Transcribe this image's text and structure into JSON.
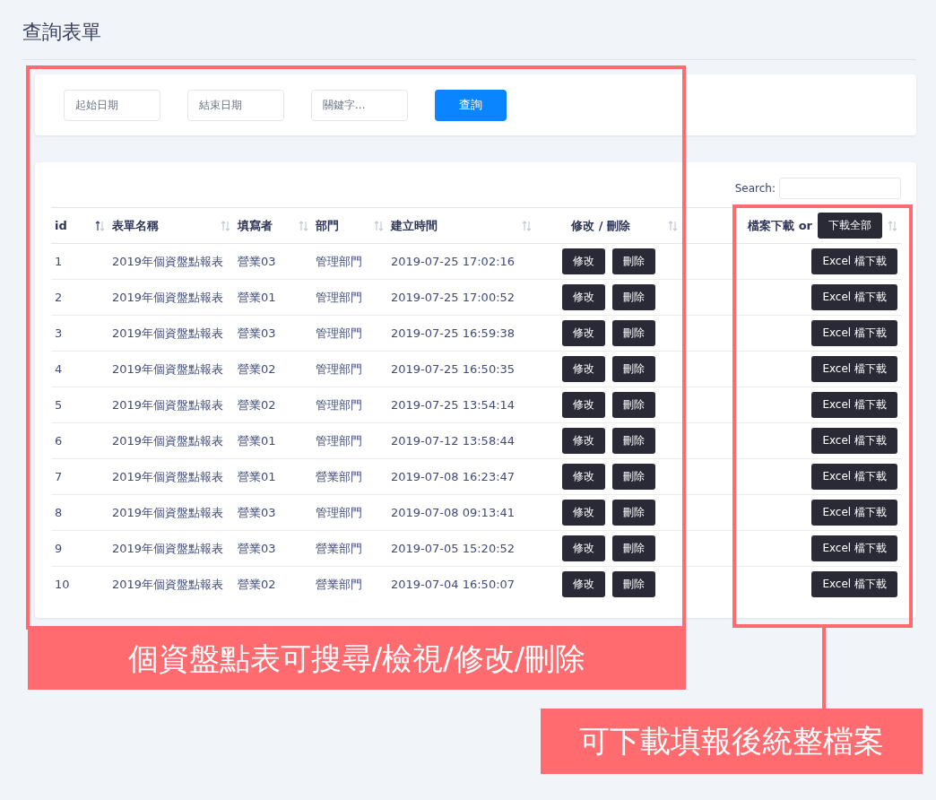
{
  "page": {
    "title": "查詢表單"
  },
  "filters": {
    "fields": [
      {
        "placeholder": "起始日期"
      },
      {
        "placeholder": "結束日期"
      },
      {
        "placeholder": "關鍵字..."
      }
    ],
    "submit": "查詢"
  },
  "table": {
    "search_label": "Search:",
    "columns": [
      {
        "label": "id",
        "sorted": true
      },
      {
        "label": "表單名稱",
        "sorted": false
      },
      {
        "label": "填寫者",
        "sorted": false
      },
      {
        "label": "部門",
        "sorted": false
      },
      {
        "label": "建立時間",
        "sorted": false
      },
      {
        "label": "修改 / 刪除",
        "sorted": false
      },
      {
        "label": "檔案下載 or",
        "button": "下載全部",
        "sorted": false
      }
    ],
    "rows": [
      {
        "id": "1",
        "name": "2019年個資盤點報表",
        "writer": "營業03",
        "dept": "管理部門",
        "created": "2019-07-25 17:02:16",
        "edit": "修改",
        "delete": "刪除",
        "download": "Excel 檔下載"
      },
      {
        "id": "2",
        "name": "2019年個資盤點報表",
        "writer": "營業01",
        "dept": "管理部門",
        "created": "2019-07-25 17:00:52",
        "edit": "修改",
        "delete": "刪除",
        "download": "Excel 檔下載"
      },
      {
        "id": "3",
        "name": "2019年個資盤點報表",
        "writer": "營業03",
        "dept": "管理部門",
        "created": "2019-07-25 16:59:38",
        "edit": "修改",
        "delete": "刪除",
        "download": "Excel 檔下載"
      },
      {
        "id": "4",
        "name": "2019年個資盤點報表",
        "writer": "營業02",
        "dept": "管理部門",
        "created": "2019-07-25 16:50:35",
        "edit": "修改",
        "delete": "刪除",
        "download": "Excel 檔下載"
      },
      {
        "id": "5",
        "name": "2019年個資盤點報表",
        "writer": "營業02",
        "dept": "管理部門",
        "created": "2019-07-25 13:54:14",
        "edit": "修改",
        "delete": "刪除",
        "download": "Excel 檔下載"
      },
      {
        "id": "6",
        "name": "2019年個資盤點報表",
        "writer": "營業01",
        "dept": "管理部門",
        "created": "2019-07-12 13:58:44",
        "edit": "修改",
        "delete": "刪除",
        "download": "Excel 檔下載"
      },
      {
        "id": "7",
        "name": "2019年個資盤點報表",
        "writer": "營業01",
        "dept": "營業部門",
        "created": "2019-07-08 16:23:47",
        "edit": "修改",
        "delete": "刪除",
        "download": "Excel 檔下載"
      },
      {
        "id": "8",
        "name": "2019年個資盤點報表",
        "writer": "營業03",
        "dept": "管理部門",
        "created": "2019-07-08 09:13:41",
        "edit": "修改",
        "delete": "刪除",
        "download": "Excel 檔下載"
      },
      {
        "id": "9",
        "name": "2019年個資盤點報表",
        "writer": "營業03",
        "dept": "營業部門",
        "created": "2019-07-05 15:20:52",
        "edit": "修改",
        "delete": "刪除",
        "download": "Excel 檔下載"
      },
      {
        "id": "10",
        "name": "2019年個資盤點報表",
        "writer": "營業02",
        "dept": "營業部門",
        "created": "2019-07-04 16:50:07",
        "edit": "修改",
        "delete": "刪除",
        "download": "Excel 檔下載"
      }
    ]
  },
  "annotations": [
    {
      "kind": "boxed",
      "text": "個資盤點表可搜尋/檢視/修改/刪除"
    },
    {
      "kind": "leader",
      "text": "可下載填報後統整檔案"
    }
  ]
}
